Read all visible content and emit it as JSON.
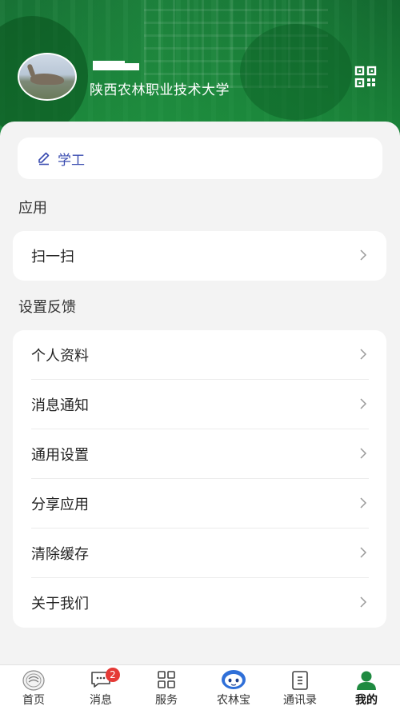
{
  "header": {
    "school_name": "陕西农林职业技术大学"
  },
  "role_card": {
    "label": "学工"
  },
  "sections": {
    "apps_title": "应用",
    "settings_title": "设置反馈"
  },
  "apps": [
    {
      "label": "扫一扫"
    }
  ],
  "settings": [
    {
      "label": "个人资料"
    },
    {
      "label": "消息通知"
    },
    {
      "label": "通用设置"
    },
    {
      "label": "分享应用"
    },
    {
      "label": "清除缓存"
    },
    {
      "label": "关于我们"
    }
  ],
  "tabbar": {
    "home": "首页",
    "messages": "消息",
    "messages_badge": "2",
    "services": "服务",
    "assistant": "农林宝",
    "contacts": "通讯录",
    "mine": "我的"
  },
  "colors": {
    "brand_green": "#1f8a40",
    "accent_blue": "#3a4cb0",
    "badge_red": "#e53935"
  },
  "icons": [
    "qr-code-icon",
    "pencil-icon",
    "chevron-right-icon",
    "school-logo-icon",
    "chat-icon",
    "grid-icon",
    "robot-icon",
    "contacts-book-icon",
    "person-icon"
  ]
}
